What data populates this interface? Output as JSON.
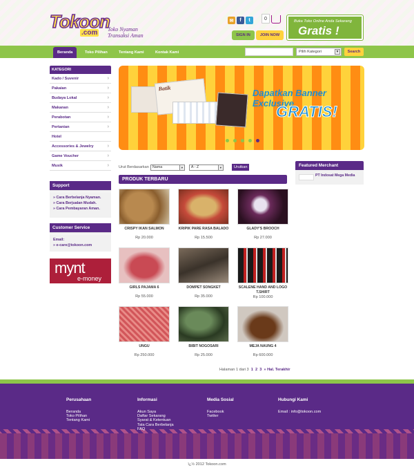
{
  "header": {
    "logo": {
      "word": "Tokoon",
      "domain": ".com",
      "tagline_1": "Toko Nyaman",
      "tagline_2": "Transaksi Aman"
    },
    "cart_count": "0",
    "signin_label": "SIGN IN",
    "join_label": "JOIN NOW",
    "promo_small": "Buka Toko Online Anda Sekarang",
    "promo_big": "Gratis !"
  },
  "nav": {
    "tabs": [
      "Beranda",
      "Toko Pilihan",
      "Tentang Kami",
      "Kontak Kami"
    ],
    "kategori_placeholder": "Pilih Kategori",
    "search_label": "Search"
  },
  "sidebar": {
    "kategori_title": "KATEGORI",
    "items": [
      "Kado / Suvenir",
      "Pakaian",
      "Budaya Lokal",
      "Makanan",
      "Perabotan",
      "Pertanian",
      "Hotel",
      "Accessories & Jewelry",
      "Game Voucher",
      "Musik"
    ],
    "support_title": "Support",
    "support_links": [
      "Cara Berbelanja Nyaman.",
      "Cara Berjualan Mudah.",
      "Cara Pembayaran Aman."
    ],
    "cs_title": "Customer Service",
    "cs_email_label": "Email:",
    "cs_email": "e-care@tokoon.com",
    "mynt_1": "mynt",
    "mynt_2": "e-money"
  },
  "banner": {
    "line1": "Dapatkan Banner Exclusive",
    "line2": "GRATIS!",
    "photo_caption": "Batik"
  },
  "sort": {
    "label": "Urut Berdasarkan",
    "field": "Nama",
    "order": "A - Z",
    "button": "Urutkan"
  },
  "products_title": "PRODUK TERBARU",
  "products": [
    {
      "name": "CRISPY IKAN SALMON",
      "price": "Rp 20.000"
    },
    {
      "name": "KRIPIK PARE RASA BALADO",
      "price": "Rp 15.500"
    },
    {
      "name": "GLADY'S BROOCH",
      "price": "Rp 27.000"
    },
    {
      "name": "GIRLS PAJAMA 6",
      "price": "Rp 55.000"
    },
    {
      "name": "DOMPET SONGKET",
      "price": "Rp 35.000"
    },
    {
      "name": "SCALENE HAND AND LOGO T.SHIRT",
      "price": "Rp 100.000"
    },
    {
      "name": "UNGU",
      "price": "Rp 250.000"
    },
    {
      "name": "BIBIT NOGOSARI",
      "price": "Rp 25.000"
    },
    {
      "name": "MEJA NAUNG 4",
      "price": "Rp 600.000"
    }
  ],
  "pager": {
    "text": "Halaman 1 dari 3",
    "p1": "1",
    "p2": "2",
    "p3": "3",
    "last": "» Hal. Terakhir"
  },
  "featured": {
    "title": "Featured Merchant",
    "merchant": "PT Indosat Mega Media"
  },
  "footer": {
    "perusahaan": {
      "title": "Perusahaan",
      "links": [
        "Beranda",
        "Toko Pilihan",
        "Tentang Kami"
      ]
    },
    "informasi": {
      "title": "Informasi",
      "links": [
        "Akun Saya",
        "Daftar Sekarang",
        "Syarat & Ketentuan",
        "Tata Cara Berbelanja",
        "FAQ"
      ]
    },
    "media": {
      "title": "Media Sosial",
      "links": [
        "Facebook",
        "Twitter"
      ]
    },
    "hubungi": {
      "title": "Hubungi Kami",
      "links": [
        "Email : info@tokoon.com"
      ]
    },
    "copyright": "ï¿½ 2012 Tokoon.com"
  },
  "colors": {
    "purple": "#5a2a87",
    "green": "#8ec54a",
    "yellow": "#ffd23d",
    "orange": "#ff8d13"
  }
}
